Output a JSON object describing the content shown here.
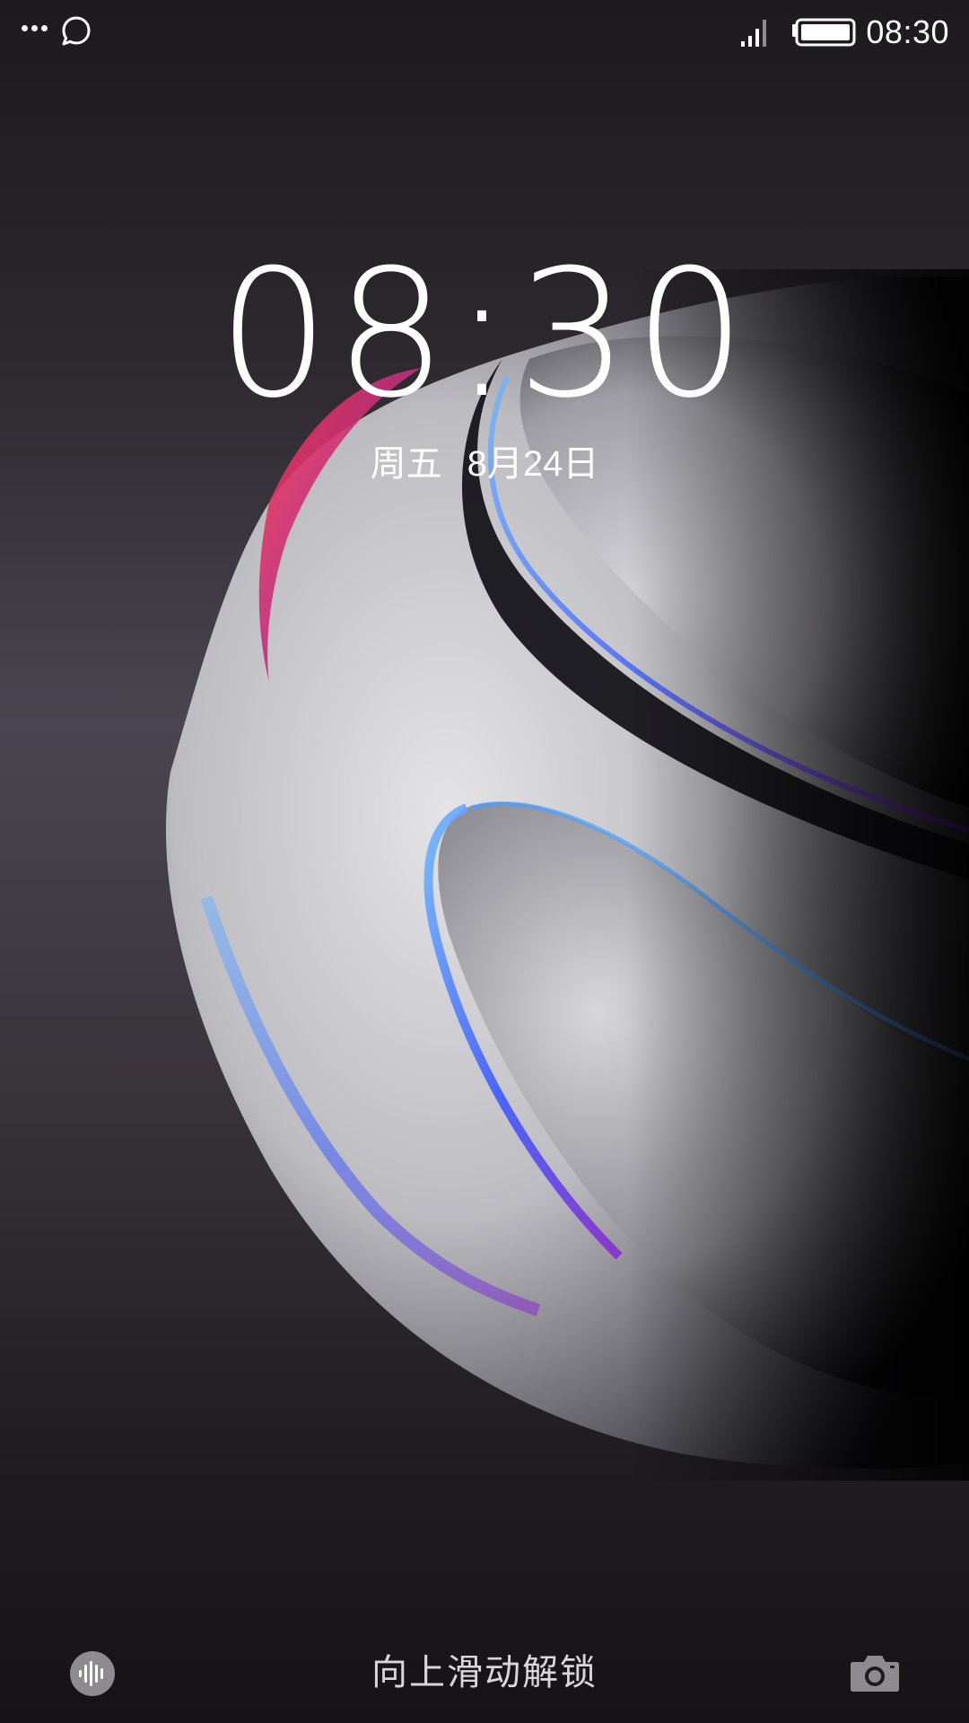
{
  "status_bar": {
    "time": "08:30",
    "icons": [
      "more-dots-icon",
      "chat-bubble-icon",
      "signal-icon",
      "battery-icon"
    ]
  },
  "lockscreen": {
    "clock": "08:30",
    "date": {
      "weekday": "周五",
      "day": "8月24日"
    },
    "unlock_hint": "向上滑动解锁"
  },
  "bottom_bar": {
    "left_icon": "voice-assistant-icon",
    "right_icon": "camera-icon"
  },
  "colors": {
    "text": "#ffffff",
    "hint_text": "#d9d6da",
    "accent_blue": "#3c7dff",
    "accent_red": "#e0304a",
    "accent_purple": "#a437d8"
  }
}
